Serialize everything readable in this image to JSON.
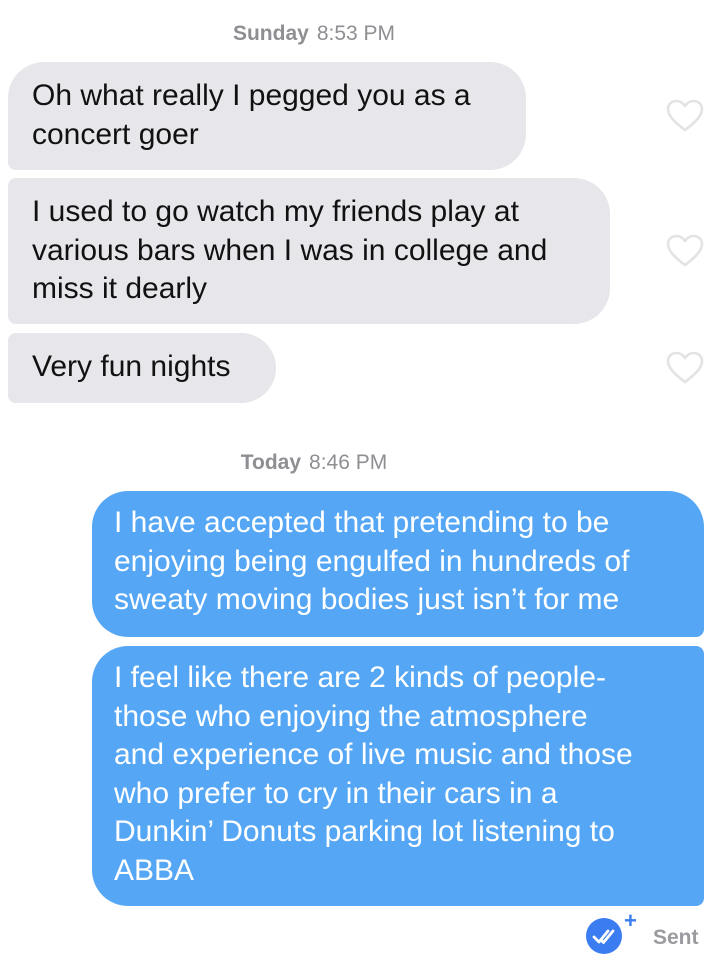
{
  "conversation": {
    "timestamps": [
      {
        "day": "Sunday",
        "time": "8:53 PM"
      },
      {
        "day": "Today",
        "time": "8:46 PM"
      }
    ],
    "received_messages": [
      {
        "text": "Oh what really I pegged you as a\nconcert goer"
      },
      {
        "text": "I used to go watch my friends play at\nvarious bars when I was in college and\nmiss it dearly"
      },
      {
        "text": "Very fun nights"
      }
    ],
    "sent_messages": [
      {
        "text": "I have accepted that pretending to be\nenjoying being engulfed in hundreds of\nsweaty moving bodies just isn’t for me"
      },
      {
        "text": "I feel like there are 2 kinds of people-\nthose who enjoying the atmosphere\nand experience of live music and those\nwho prefer to cry in their cars in a\nDunkin’ Donuts parking lot listening to\nABBA"
      }
    ],
    "status": {
      "label": "Sent"
    }
  },
  "icons": {
    "like": "heart-outline-icon",
    "read_receipt": "double-check-icon"
  },
  "colors": {
    "received_bubble": "#e6e6eb",
    "sent_bubble": "#55a7f5",
    "accent": "#3b7df0",
    "meta_text": "#8e8e93"
  }
}
